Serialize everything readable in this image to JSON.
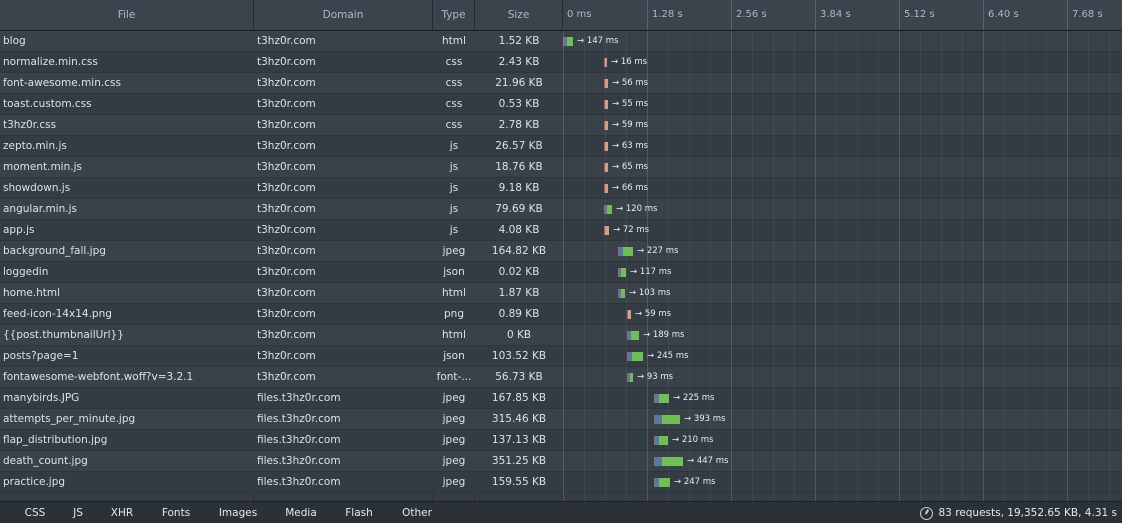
{
  "columns": {
    "file": "File",
    "domain": "Domain",
    "type": "Type",
    "size": "Size"
  },
  "timeline_ticks": [
    "0 ms",
    "1.28 s",
    "2.56 s",
    "3.84 s",
    "5.12 s",
    "6.40 s",
    "7.68 s"
  ],
  "timeline_max_ms": 8500,
  "colors": {
    "waiting": "#5779a2",
    "receiving": "#70bf53",
    "connecting": "#d1a07d",
    "sending": "#b2567d"
  },
  "rows": [
    {
      "file": "blog",
      "domain": "t3hz0r.com",
      "type": "html",
      "size": "1.52 KB",
      "start": 0,
      "dur": 147,
      "label": "→ 147 ms"
    },
    {
      "file": "normalize.min.css",
      "domain": "t3hz0r.com",
      "type": "css",
      "size": "2.43 KB",
      "start": 620,
      "dur": 16,
      "label": "→ 16 ms"
    },
    {
      "file": "font-awesome.min.css",
      "domain": "t3hz0r.com",
      "type": "css",
      "size": "21.96 KB",
      "start": 630,
      "dur": 56,
      "label": "→ 56 ms"
    },
    {
      "file": "toast.custom.css",
      "domain": "t3hz0r.com",
      "type": "css",
      "size": "0.53 KB",
      "start": 630,
      "dur": 55,
      "label": "→ 55 ms"
    },
    {
      "file": "t3hz0r.css",
      "domain": "t3hz0r.com",
      "type": "css",
      "size": "2.78 KB",
      "start": 630,
      "dur": 59,
      "label": "→ 59 ms"
    },
    {
      "file": "zepto.min.js",
      "domain": "t3hz0r.com",
      "type": "js",
      "size": "26.57 KB",
      "start": 630,
      "dur": 63,
      "label": "→ 63 ms"
    },
    {
      "file": "moment.min.js",
      "domain": "t3hz0r.com",
      "type": "js",
      "size": "18.76 KB",
      "start": 630,
      "dur": 65,
      "label": "→ 65 ms"
    },
    {
      "file": "showdown.js",
      "domain": "t3hz0r.com",
      "type": "js",
      "size": "9.18 KB",
      "start": 630,
      "dur": 66,
      "label": "→ 66 ms"
    },
    {
      "file": "angular.min.js",
      "domain": "t3hz0r.com",
      "type": "js",
      "size": "79.69 KB",
      "start": 630,
      "dur": 120,
      "label": "→ 120 ms"
    },
    {
      "file": "app.js",
      "domain": "t3hz0r.com",
      "type": "js",
      "size": "4.08 KB",
      "start": 630,
      "dur": 72,
      "label": "→ 72 ms"
    },
    {
      "file": "background_fall.jpg",
      "domain": "t3hz0r.com",
      "type": "jpeg",
      "size": "164.82 KB",
      "start": 840,
      "dur": 227,
      "label": "→ 227 ms"
    },
    {
      "file": "loggedin",
      "domain": "t3hz0r.com",
      "type": "json",
      "size": "0.02 KB",
      "start": 840,
      "dur": 117,
      "label": "→ 117 ms"
    },
    {
      "file": "home.html",
      "domain": "t3hz0r.com",
      "type": "html",
      "size": "1.87 KB",
      "start": 840,
      "dur": 103,
      "label": "→ 103 ms"
    },
    {
      "file": "feed-icon-14x14.png",
      "domain": "t3hz0r.com",
      "type": "png",
      "size": "0.89 KB",
      "start": 980,
      "dur": 59,
      "label": "→ 59 ms"
    },
    {
      "file": "{{post.thumbnailUrl}}",
      "domain": "t3hz0r.com",
      "type": "html",
      "size": "0 KB",
      "start": 980,
      "dur": 189,
      "label": "→ 189 ms"
    },
    {
      "file": "posts?page=1",
      "domain": "t3hz0r.com",
      "type": "json",
      "size": "103.52 KB",
      "start": 980,
      "dur": 245,
      "label": "→ 245 ms"
    },
    {
      "file": "fontawesome-webfont.woff?v=3.2.1",
      "domain": "t3hz0r.com",
      "type": "font-...",
      "size": "56.73 KB",
      "start": 980,
      "dur": 93,
      "label": "→ 93 ms"
    },
    {
      "file": "manybirds.JPG",
      "domain": "files.t3hz0r.com",
      "type": "jpeg",
      "size": "167.85 KB",
      "start": 1380,
      "dur": 225,
      "label": "→ 225 ms"
    },
    {
      "file": "attempts_per_minute.jpg",
      "domain": "files.t3hz0r.com",
      "type": "jpeg",
      "size": "315.46 KB",
      "start": 1380,
      "dur": 393,
      "label": "→ 393 ms"
    },
    {
      "file": "flap_distribution.jpg",
      "domain": "files.t3hz0r.com",
      "type": "jpeg",
      "size": "137.13 KB",
      "start": 1380,
      "dur": 210,
      "label": "→ 210 ms"
    },
    {
      "file": "death_count.jpg",
      "domain": "files.t3hz0r.com",
      "type": "jpeg",
      "size": "351.25 KB",
      "start": 1380,
      "dur": 447,
      "label": "→ 447 ms"
    },
    {
      "file": "practice.jpg",
      "domain": "files.t3hz0r.com",
      "type": "jpeg",
      "size": "159.55 KB",
      "start": 1380,
      "dur": 247,
      "label": "→ 247 ms"
    }
  ],
  "footer": {
    "tabs": [
      "CSS",
      "JS",
      "XHR",
      "Fonts",
      "Images",
      "Media",
      "Flash",
      "Other"
    ],
    "status": "83 requests, 19,352.65 KB, 4.31 s"
  }
}
